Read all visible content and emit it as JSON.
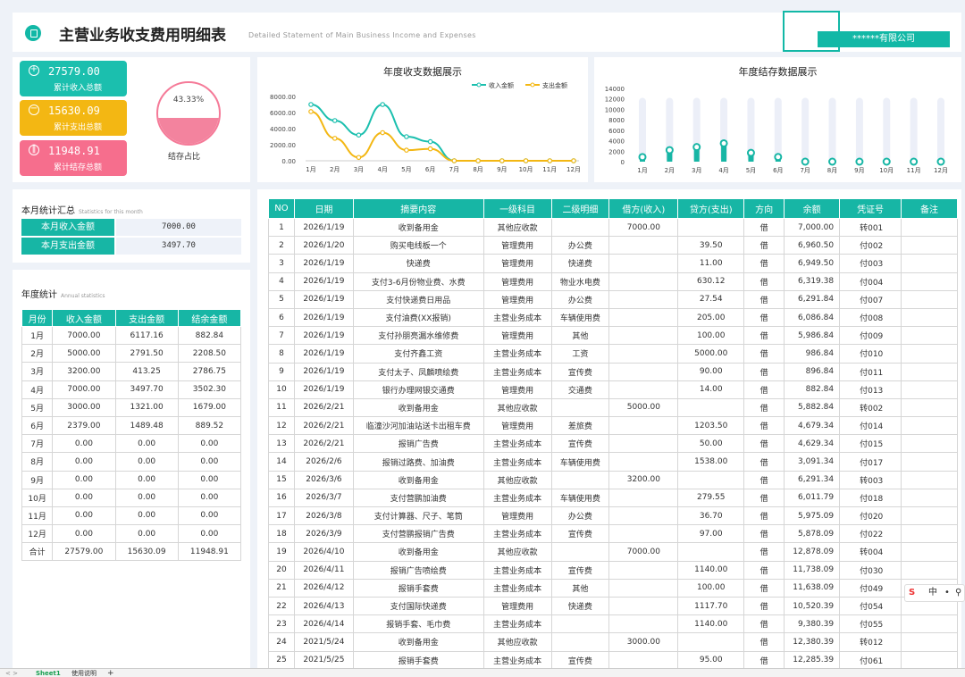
{
  "header": {
    "title": "主营业务收支费用明细表",
    "subtitle": "Detailed Statement of Main Business Income and Expenses",
    "company": "******有限公司"
  },
  "summary": {
    "income_value": "27579.00",
    "income_label": "累计收入总额",
    "expense_value": "15630.09",
    "expense_label": "累计支出总额",
    "balance_value": "11948.91",
    "balance_label": "累计结存总额",
    "ratio_text": "43.33%",
    "ratio_fraction": 0.4333,
    "ratio_label": "结存占比"
  },
  "month_stats": {
    "title": "本月统计汇总",
    "subtitle": "Statistics for this month",
    "income_label": "本月收入金额",
    "income_value": "7000.00",
    "expense_label": "本月支出金额",
    "expense_value": "3497.70"
  },
  "annual": {
    "title": "年度统计",
    "subtitle": "Annual statistics",
    "headers": [
      "月份",
      "收入金额",
      "支出金额",
      "结余金额"
    ],
    "rows": [
      [
        "1月",
        "7000.00",
        "6117.16",
        "882.84"
      ],
      [
        "2月",
        "5000.00",
        "2791.50",
        "2208.50"
      ],
      [
        "3月",
        "3200.00",
        "413.25",
        "2786.75"
      ],
      [
        "4月",
        "7000.00",
        "3497.70",
        "3502.30"
      ],
      [
        "5月",
        "3000.00",
        "1321.00",
        "1679.00"
      ],
      [
        "6月",
        "2379.00",
        "1489.48",
        "889.52"
      ],
      [
        "7月",
        "0.00",
        "0.00",
        "0.00"
      ],
      [
        "8月",
        "0.00",
        "0.00",
        "0.00"
      ],
      [
        "9月",
        "0.00",
        "0.00",
        "0.00"
      ],
      [
        "10月",
        "0.00",
        "0.00",
        "0.00"
      ],
      [
        "11月",
        "0.00",
        "0.00",
        "0.00"
      ],
      [
        "12月",
        "0.00",
        "0.00",
        "0.00"
      ],
      [
        "合计",
        "27579.00",
        "15630.09",
        "11948.91"
      ]
    ]
  },
  "detail": {
    "headers": [
      "NO",
      "日期",
      "摘要内容",
      "一级科目",
      "二级明细",
      "借方(收入)",
      "贷方(支出)",
      "方向",
      "余额",
      "凭证号",
      "备注"
    ],
    "rows": [
      [
        "1",
        "2026/1/19",
        "收到备用金",
        "其他应收款",
        "",
        "7000.00",
        "",
        "借",
        "7,000.00",
        "转001",
        ""
      ],
      [
        "2",
        "2026/1/20",
        "购买电线板一个",
        "管理费用",
        "办公费",
        "",
        "39.50",
        "借",
        "6,960.50",
        "付002",
        ""
      ],
      [
        "3",
        "2026/1/19",
        "快递费",
        "管理费用",
        "快递费",
        "",
        "11.00",
        "借",
        "6,949.50",
        "付003",
        ""
      ],
      [
        "4",
        "2026/1/19",
        "支付3-6月份物业费、水费",
        "管理费用",
        "物业水电费",
        "",
        "630.12",
        "借",
        "6,319.38",
        "付004",
        ""
      ],
      [
        "5",
        "2026/1/19",
        "支付快递费日用品",
        "管理费用",
        "办公费",
        "",
        "27.54",
        "借",
        "6,291.84",
        "付007",
        ""
      ],
      [
        "6",
        "2026/1/19",
        "支付油费(XX报销)",
        "主营业务成本",
        "车辆使用费",
        "",
        "205.00",
        "借",
        "6,086.84",
        "付008",
        ""
      ],
      [
        "7",
        "2026/1/19",
        "支付孙朋亮漏水维修费",
        "管理费用",
        "其他",
        "",
        "100.00",
        "借",
        "5,986.84",
        "付009",
        ""
      ],
      [
        "8",
        "2026/1/19",
        "支付齐鑫工资",
        "主营业务成本",
        "工资",
        "",
        "5000.00",
        "借",
        "986.84",
        "付010",
        ""
      ],
      [
        "9",
        "2026/1/19",
        "支付太子、凤麟喷绘费",
        "主营业务成本",
        "宣传费",
        "",
        "90.00",
        "借",
        "896.84",
        "付011",
        ""
      ],
      [
        "10",
        "2026/1/19",
        "银行办理网银交通费",
        "管理费用",
        "交通费",
        "",
        "14.00",
        "借",
        "882.84",
        "付013",
        ""
      ],
      [
        "11",
        "2026/2/21",
        "收到备用金",
        "其他应收款",
        "",
        "5000.00",
        "",
        "借",
        "5,882.84",
        "转002",
        ""
      ],
      [
        "12",
        "2026/2/21",
        "临潼沙河加油站送卡出租车费",
        "管理费用",
        "差旅费",
        "",
        "1203.50",
        "借",
        "4,679.34",
        "付014",
        ""
      ],
      [
        "13",
        "2026/2/21",
        "报销广告费",
        "主营业务成本",
        "宣传费",
        "",
        "50.00",
        "借",
        "4,629.34",
        "付015",
        ""
      ],
      [
        "14",
        "2026/2/6",
        "报销过路费、加油费",
        "主营业务成本",
        "车辆使用费",
        "",
        "1538.00",
        "借",
        "3,091.34",
        "付017",
        ""
      ],
      [
        "15",
        "2026/3/6",
        "收到备用金",
        "其他应收款",
        "",
        "3200.00",
        "",
        "借",
        "6,291.34",
        "转003",
        ""
      ],
      [
        "16",
        "2026/3/7",
        "支付营鹏加油费",
        "主营业务成本",
        "车辆使用费",
        "",
        "279.55",
        "借",
        "6,011.79",
        "付018",
        ""
      ],
      [
        "17",
        "2026/3/8",
        "支付计算器、尺子、笔筒",
        "管理费用",
        "办公费",
        "",
        "36.70",
        "借",
        "5,975.09",
        "付020",
        ""
      ],
      [
        "18",
        "2026/3/9",
        "支付营鹏报销广告费",
        "主营业务成本",
        "宣传费",
        "",
        "97.00",
        "借",
        "5,878.09",
        "付022",
        ""
      ],
      [
        "19",
        "2026/4/10",
        "收到备用金",
        "其他应收款",
        "",
        "7000.00",
        "",
        "借",
        "12,878.09",
        "转004",
        ""
      ],
      [
        "20",
        "2026/4/11",
        "报销广告喷绘费",
        "主营业务成本",
        "宣传费",
        "",
        "1140.00",
        "借",
        "11,738.09",
        "付030",
        ""
      ],
      [
        "21",
        "2026/4/12",
        "报销手套费",
        "主营业务成本",
        "其他",
        "",
        "100.00",
        "借",
        "11,638.09",
        "付049",
        ""
      ],
      [
        "22",
        "2026/4/13",
        "支付国际快递费",
        "管理费用",
        "快递费",
        "",
        "1117.70",
        "借",
        "10,520.39",
        "付054",
        ""
      ],
      [
        "23",
        "2026/4/14",
        "报销手套、毛巾费",
        "主营业务成本",
        "",
        "",
        "1140.00",
        "借",
        "9,380.39",
        "付055",
        ""
      ],
      [
        "24",
        "2021/5/24",
        "收到备用金",
        "其他应收款",
        "",
        "3000.00",
        "",
        "借",
        "12,380.39",
        "转012",
        ""
      ],
      [
        "25",
        "2021/5/25",
        "报销手套费",
        "主营业务成本",
        "宣传费",
        "",
        "95.00",
        "借",
        "12,285.39",
        "付061",
        ""
      ]
    ]
  },
  "chart_data": [
    {
      "type": "line",
      "title": "年度收支数据展示",
      "categories": [
        "1月",
        "2月",
        "3月",
        "4月",
        "5月",
        "6月",
        "7月",
        "8月",
        "9月",
        "10月",
        "11月",
        "12月"
      ],
      "ylim": [
        0,
        8000
      ],
      "yticks": [
        "8000.00",
        "6000.00",
        "4000.00",
        "2000.00",
        "0.00"
      ],
      "legend_position": "top-right",
      "series": [
        {
          "name": "收入金额",
          "color": "#1bbfae",
          "values": [
            7000,
            5000,
            3200,
            7000,
            3000,
            2379,
            0,
            0,
            0,
            0,
            0,
            0
          ]
        },
        {
          "name": "支出金额",
          "color": "#f3b713",
          "values": [
            6117.16,
            2791.5,
            413.25,
            3497.7,
            1321,
            1489.48,
            0,
            0,
            0,
            0,
            0,
            0
          ]
        }
      ]
    },
    {
      "type": "bar",
      "title": "年度结存数据展示",
      "categories": [
        "1月",
        "2月",
        "3月",
        "4月",
        "5月",
        "6月",
        "7月",
        "8月",
        "9月",
        "10月",
        "11月",
        "12月"
      ],
      "ylim": [
        0,
        14000
      ],
      "yticks": [
        "14000",
        "12000",
        "10000",
        "8000",
        "6000",
        "4000",
        "2000",
        "0"
      ],
      "series": [
        {
          "color": "#17b6a5",
          "values": [
            882.84,
            2208.5,
            2786.75,
            3502.3,
            1679,
            889.52,
            0,
            0,
            0,
            0,
            0,
            0
          ]
        }
      ]
    }
  ],
  "footer": {
    "sheet1": "Sheet1",
    "sheet2": "使用说明",
    "add": "+",
    "nav": "< >"
  },
  "ime": {
    "logo": "S",
    "lang": "中",
    "dot": "•",
    "mic": "⚲"
  }
}
